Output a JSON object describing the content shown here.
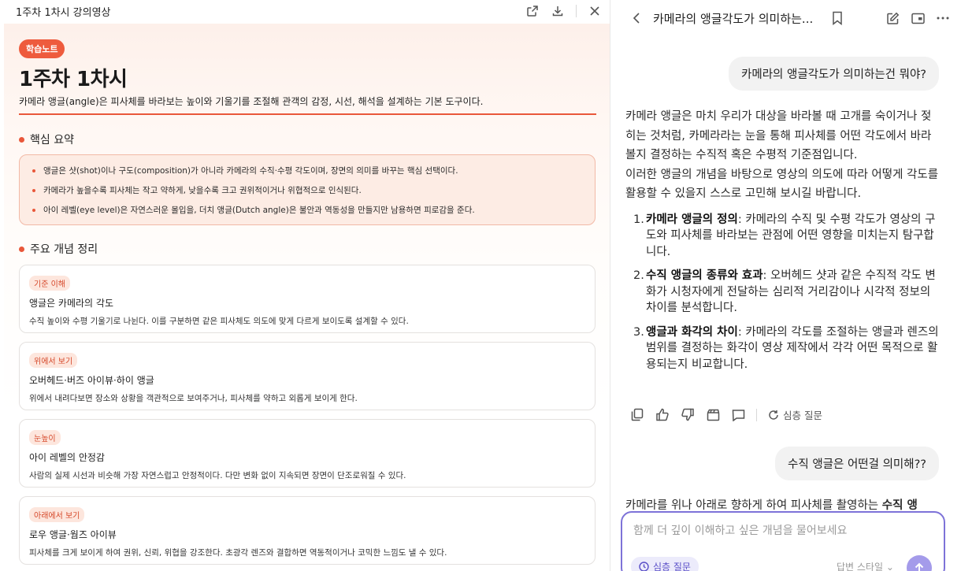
{
  "left_panel": {
    "window_title": "1주차 1차시 강의영상",
    "badge": "학습노트",
    "title": "1주차 1차시",
    "lead": "카메라 앵글(angle)은 피사체를 바라보는 높이와 기울기를 조절해 관객의 감정, 시선, 해석을 설계하는 기본 도구이다.",
    "summary_heading": "핵심 요약",
    "summary_items": [
      "앵글은 샷(shot)이나 구도(composition)가 아니라 카메라의 수직·수평 각도이며, 장면의 의미를 바꾸는 핵심 선택이다.",
      "카메라가 높을수록 피사체는 작고 약하게, 낮을수록 크고 권위적이거나 위협적으로 인식된다.",
      "아이 레벨(eye level)은 자연스러운 몰입을, 더치 앵글(Dutch angle)은 불안과 역동성을 만들지만 남용하면 피로감을 준다."
    ],
    "concepts_heading": "주요 개념 정리",
    "concepts": [
      {
        "tag": "기준 이해",
        "title": "앵글은 카메라의 각도",
        "desc": "수직 높이와 수평 기울기로 나뉜다. 이를 구분하면 같은 피사체도 의도에 맞게 다르게 보이도록 설계할 수 있다."
      },
      {
        "tag": "위에서 보기",
        "title": "오버헤드·버즈 아이뷰·하이 앵글",
        "desc": "위에서 내려다보면 장소와 상황을 객관적으로 보여주거나, 피사체를 약하고 외롭게 보이게 한다."
      },
      {
        "tag": "눈높이",
        "title": "아이 레벨의 안정감",
        "desc": "사람의 실제 시선과 비슷해 가장 자연스럽고 안정적이다. 다만 변화 없이 지속되면 장면이 단조로워질 수 있다."
      },
      {
        "tag": "아래에서 보기",
        "title": "로우 앵글·웜즈 아이뷰",
        "desc": "피사체를 크게 보이게 하여 권위, 신뢰, 위협을 강조한다. 초광각 렌즈와 결합하면 역동적이거나 코믹한 느낌도 낼 수 있다."
      }
    ]
  },
  "right_panel": {
    "title": "카메라의 앵글각도가 의미하는...",
    "user_message_1": "카메라의 앵글각도가 의미하는건 뭐야?",
    "answer_para_1": "카메라 앵글은 마치 우리가 대상을 바라볼 때 고개를 숙이거나 젖히는 것처럼, 카메라라는 눈을 통해 피사체를 어떤 각도에서 바라볼지 결정하는 수직적 혹은 수평적 기준점입니다.",
    "answer_para_2": "이러한 앵글의 개념을 바탕으로 영상의 의도에 따라 어떻게 각도를 활용할 수 있을지 스스로 고민해 보시길 바랍니다.",
    "answer_items": [
      {
        "num": "1.",
        "bold": "카메라 앵글의 정의",
        "text": ": 카메라의 수직 및 수평 각도가 영상의 구도와 피사체를 바라보는 관점에 어떤 영향을 미치는지 탐구합니다."
      },
      {
        "num": "2.",
        "bold": "수직 앵글의 종류와 효과",
        "text": ": 오버헤드 샷과 같은 수직적 각도 변화가 시청자에게 전달하는 심리적 거리감이나 시각적 정보의 차이를 분석합니다."
      },
      {
        "num": "3.",
        "bold": "앵글과 화각의 차이",
        "text": ": 카메라의 각도를 조절하는 앵글과 렌즈의 범위를 결정하는 화각이 영상 제작에서 각각 어떤 목적으로 활용되는지 비교합니다."
      }
    ],
    "deep_question_label": "심층 질문",
    "user_message_2": "수직 앵글은 어떤걸 의미해??",
    "cut_line_prefix": "카메라를 위나 아래로 향하게 하여 피사체를 촬영하는 ",
    "cut_line_bold": "수직 앵",
    "composer": {
      "placeholder": "함께 더 깊이 이해하고 싶은 개념을 물어보세요",
      "chip_label": "심층 질문",
      "style_label": "답변 스타일"
    }
  },
  "colors": {
    "accent": "#e9573a",
    "composer_border": "#7d72d8",
    "send_button": "#a49bea"
  }
}
